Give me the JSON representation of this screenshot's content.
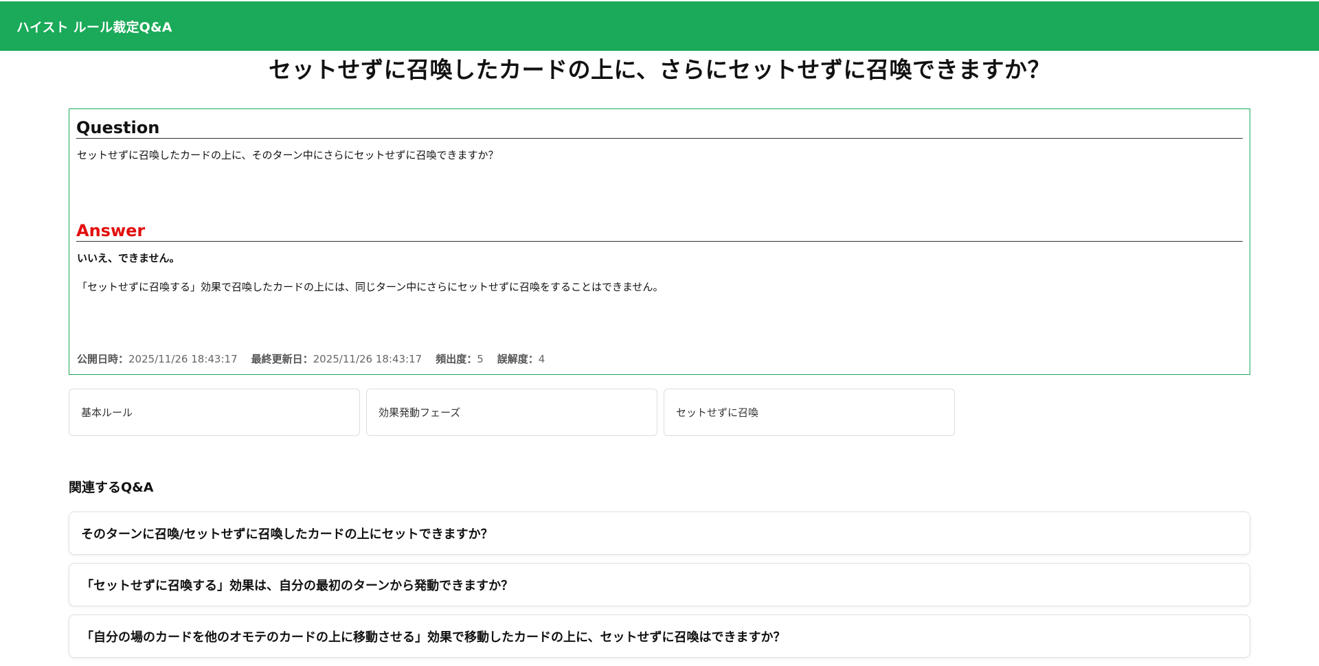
{
  "header": {
    "site_title": "ハイスト ルール裁定Q&A",
    "brand_color": "#1aaa59"
  },
  "page_title": "セットせずに召喚したカードの上に、さらにセットせずに召喚できますか？",
  "question": {
    "heading": "Question",
    "text": "セットせずに召喚したカードの上に、そのターン中にさらにセットせずに召喚できますか？"
  },
  "answer": {
    "heading": "Answer",
    "heading_color": "#e30e0e",
    "lead": "いいえ、できません。",
    "text": "「セットせずに召喚する」効果で召喚したカードの上には、同じターン中にさらにセットせずに召喚をすることはできません。"
  },
  "meta": {
    "published_label": "公開日時：",
    "published_value": "2025/11/26 18:43:17",
    "updated_label": "最終更新日：",
    "updated_value": "2025/11/26 18:43:17",
    "frequency_label": "頻出度：",
    "frequency_value": "5",
    "misunderstanding_label": "誤解度：",
    "misunderstanding_value": "4"
  },
  "tags": [
    {
      "label": "基本ルール"
    },
    {
      "label": "効果発動フェーズ"
    },
    {
      "label": "セットせずに召喚"
    }
  ],
  "related": {
    "title": "関連するQ&A",
    "items": [
      {
        "label": "そのターンに召喚/セットせずに召喚したカードの上にセットできますか？"
      },
      {
        "label": "「セットせずに召喚する」効果は、自分の最初のターンから発動できますか？"
      },
      {
        "label": "「自分の場のカードを他のオモテのカードの上に移動させる」効果で移動したカードの上に、セットせずに召喚はできますか？"
      }
    ]
  }
}
